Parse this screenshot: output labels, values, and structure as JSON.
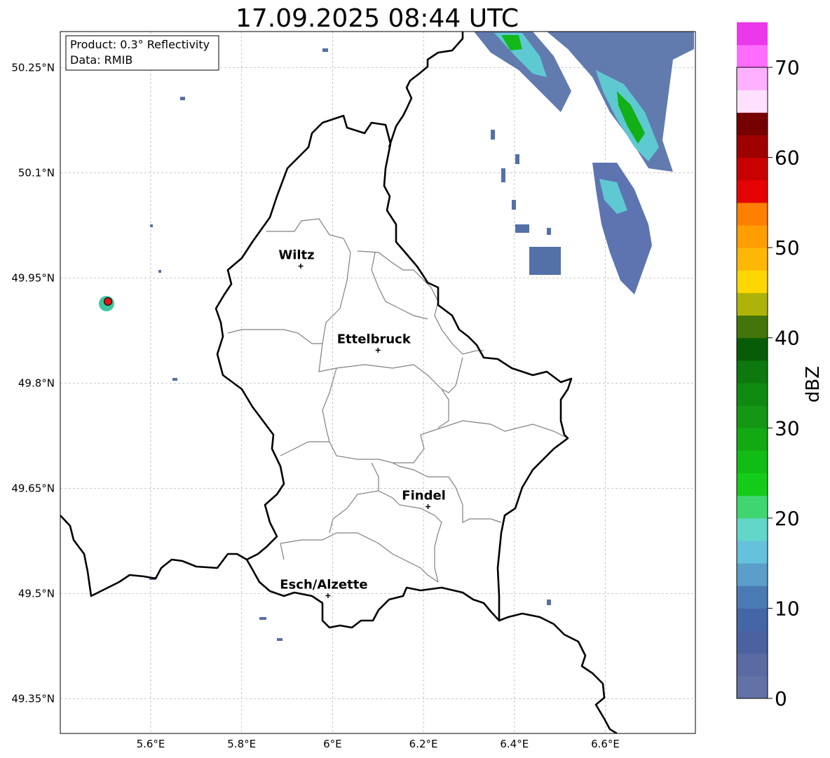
{
  "title": "17.09.2025 08:44 UTC",
  "info_box": {
    "product": "Product: 0.3° Reflectivity",
    "data": "Data: RMIB"
  },
  "lat_labels": [
    "50.25°N",
    "50.1°N",
    "49.95°N",
    "49.8°N",
    "49.65°N",
    "49.5°N",
    "49.35°N"
  ],
  "lon_labels": [
    "5.6°E",
    "5.8°E",
    "6°E",
    "6.2°E",
    "6.4°E",
    "6.6°E"
  ],
  "cities": [
    {
      "name": "Wiltz",
      "lon": 5.93,
      "lat": 49.967
    },
    {
      "name": "Ettelbruck",
      "lon": 6.1,
      "lat": 49.847
    },
    {
      "name": "Findel",
      "lon": 6.21,
      "lat": 49.624
    },
    {
      "name": "Esch/Alzette",
      "lon": 5.99,
      "lat": 49.497
    }
  ],
  "colorbar": {
    "label": "dBZ",
    "tick_labels": [
      "0",
      "10",
      "20",
      "30",
      "40",
      "50",
      "60",
      "70"
    ],
    "min": 0,
    "max": 70,
    "step": 2.5,
    "colors": [
      "#6272a6",
      "#5a6aa2",
      "#4b62a0",
      "#4466a6",
      "#4a7ab4",
      "#5a9ec9",
      "#66c1dc",
      "#62d6c8",
      "#3fd672",
      "#13cc19",
      "#11bd15",
      "#12aa12",
      "#149714",
      "#0f8a10",
      "#0c780d",
      "#075d07",
      "#43760a",
      "#afb309",
      "#fed700",
      "#fdb705",
      "#ff9e00",
      "#ff7f00",
      "#e60303",
      "#c90000",
      "#9e0000",
      "#760000",
      "#ffe1ff",
      "#ffb1ff",
      "#ff6cfe",
      "#ea38ea"
    ]
  },
  "radar_site_color": "#e11414"
}
